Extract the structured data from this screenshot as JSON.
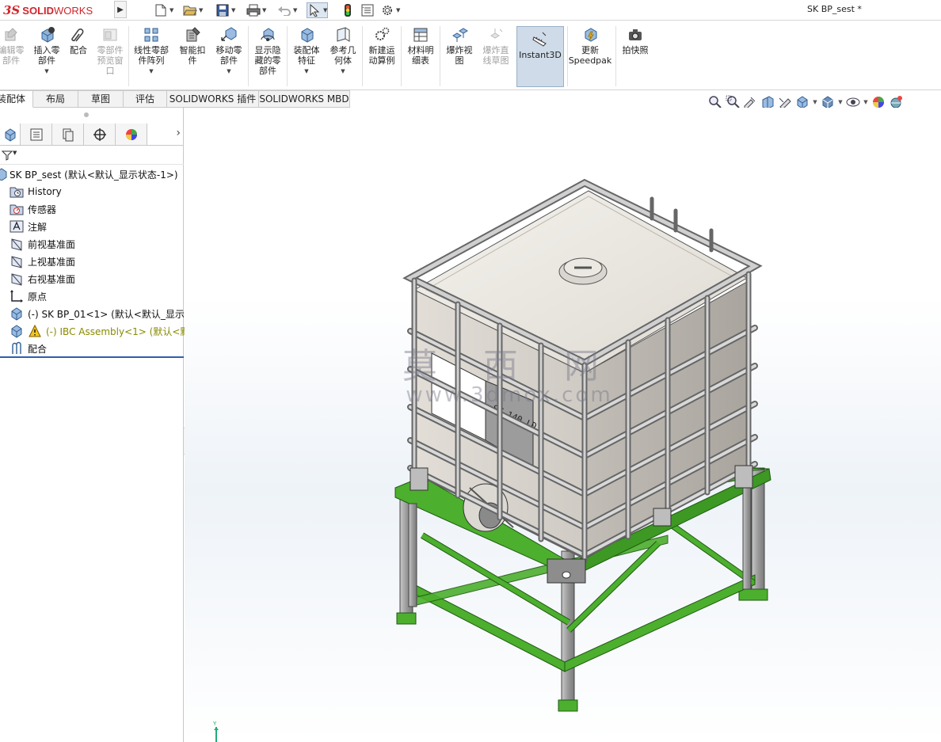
{
  "app": {
    "logo_ds": "3S",
    "logo_solid": "SOLID",
    "logo_works": "WORKS",
    "document_title": "SK BP_sest *"
  },
  "quick_access": [
    {
      "name": "new-document-icon"
    },
    {
      "name": "open-icon"
    },
    {
      "name": "save-icon"
    },
    {
      "name": "print-icon"
    },
    {
      "name": "undo-icon"
    },
    {
      "name": "select-arrow-icon"
    },
    {
      "name": "rebuild-traffic-light-icon"
    },
    {
      "name": "file-properties-icon"
    },
    {
      "name": "options-gear-icon"
    }
  ],
  "ribbon": {
    "edit_component": "编辑零\n部件",
    "insert_component": "插入零\n部件",
    "mate": "配合",
    "component_preview": "零部件\n预览窗\n口",
    "linear_pattern": "线性零部\n件阵列",
    "smart_fasteners": "智能扣\n件",
    "move_component": "移动零\n部件",
    "show_hidden": "显示隐\n藏的零\n部件",
    "assembly_features": "装配体\n特征",
    "reference_geometry": "参考几\n何体",
    "new_motion_study": "新建运\n动算例",
    "bill_of_materials": "材料明\n细表",
    "exploded_view": "爆炸视\n图",
    "explode_line": "爆炸直\n线草图",
    "instant3d": "Instant3D",
    "update_speedpak": "更新\nSpeedpak",
    "snapshot": "拍快照"
  },
  "tabs": [
    "装配体",
    "布局",
    "草图",
    "评估",
    "SOLIDWORKS 插件",
    "SOLIDWORKS MBD"
  ],
  "tree": {
    "root": "SK BP_sest  (默认<默认_显示状态-1>)",
    "items": [
      {
        "label": "History",
        "icon": "history-folder-icon"
      },
      {
        "label": "传感器",
        "icon": "sensor-icon"
      },
      {
        "label": "注解",
        "icon": "annotation-icon"
      },
      {
        "label": "前视基准面",
        "icon": "plane-icon"
      },
      {
        "label": "上视基准面",
        "icon": "plane-icon"
      },
      {
        "label": "右视基准面",
        "icon": "plane-icon"
      },
      {
        "label": "原点",
        "icon": "origin-icon"
      },
      {
        "label": "(-) SK BP_01<1> (默认<默认_显示状",
        "icon": "part-icon"
      },
      {
        "label": "(-) IBC Assembly<1> (默认<默",
        "icon": "warning-icon"
      },
      {
        "label": "配合",
        "icon": "mates-icon"
      }
    ]
  },
  "viewport": {
    "watermark_line1": "莫 西 网",
    "watermark_line2": "www.3dmox.com",
    "tank_label": "ST 140 LD",
    "triad_y": "Y"
  },
  "colors": {
    "frame_green": "#4caf2e",
    "tank_white": "#e9e6e0",
    "steel_gray": "#9a9a9a",
    "instant3d_active": "#cfdbe8",
    "logo_red": "#d2232a"
  }
}
